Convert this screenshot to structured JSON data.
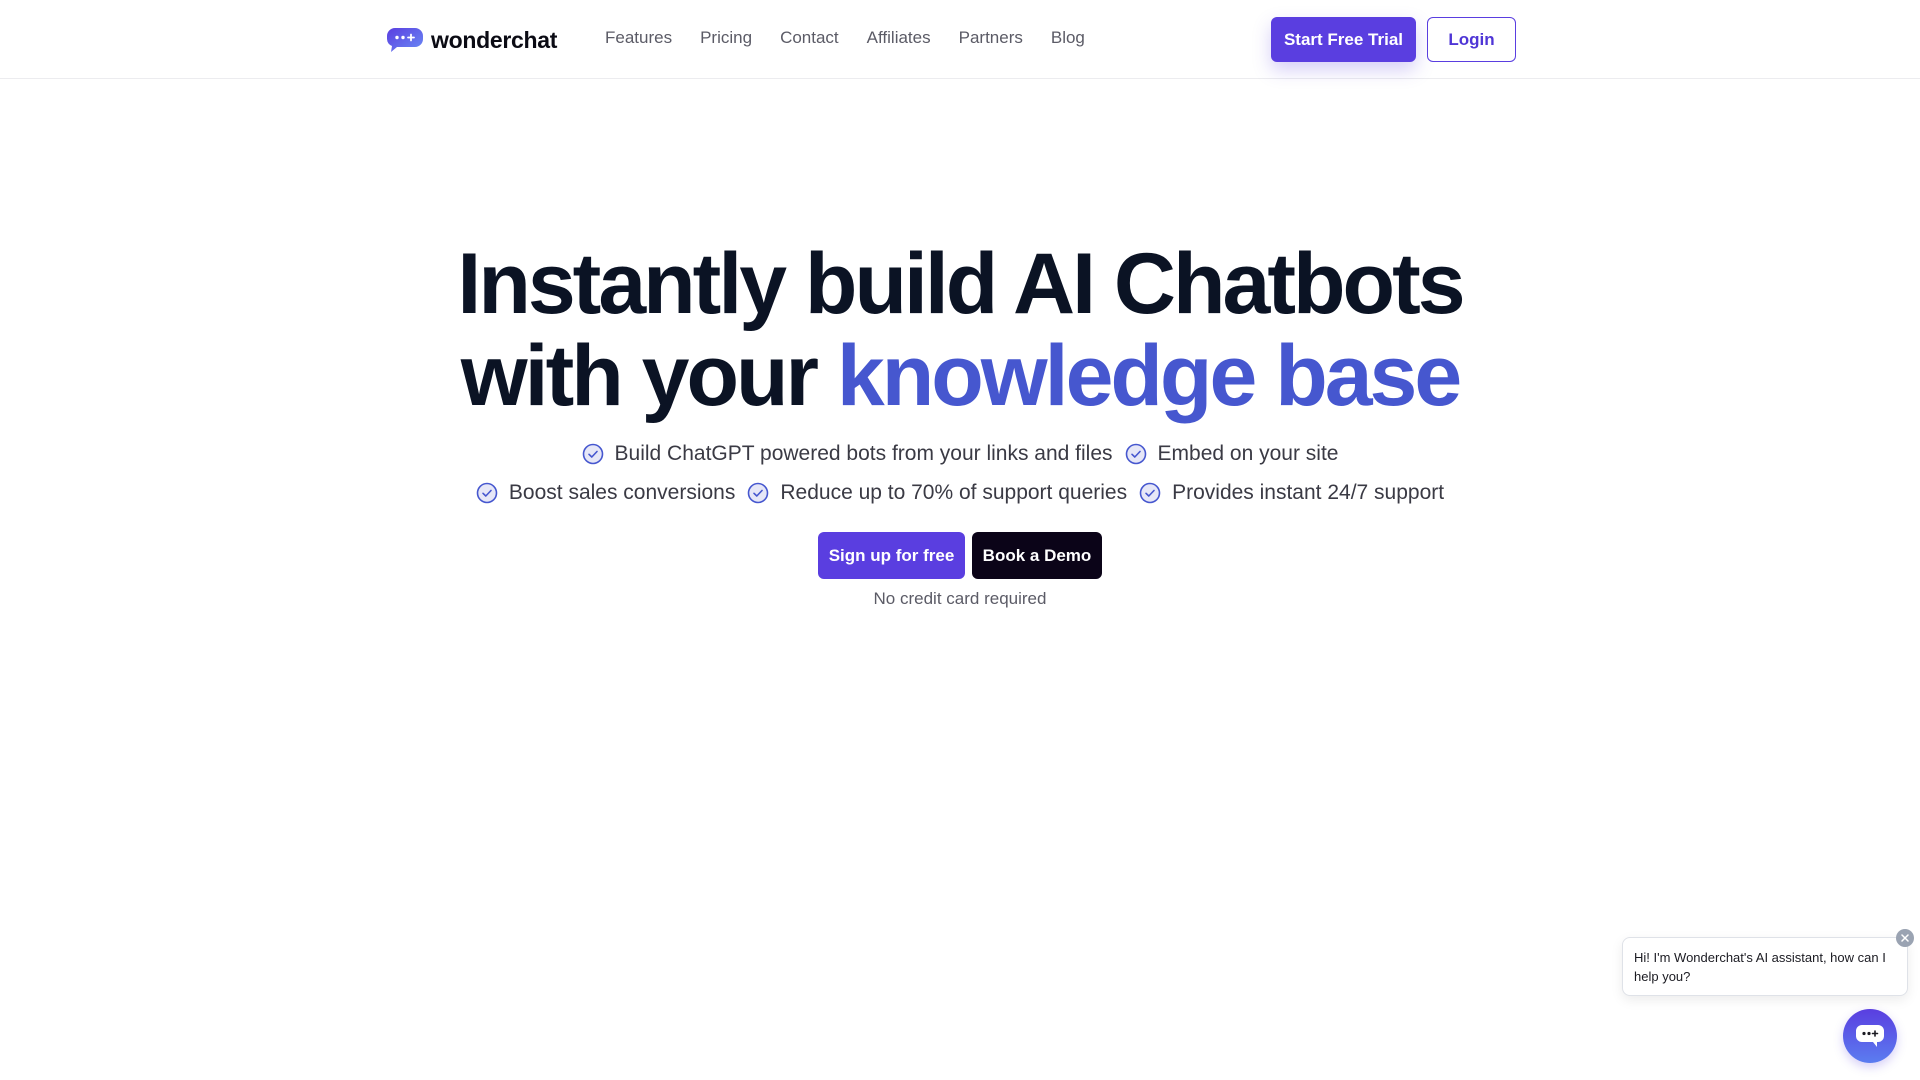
{
  "brand": {
    "name": "wonderchat",
    "accent_color": "#5a3ee0",
    "highlight_color": "#4657cf"
  },
  "nav": {
    "links": [
      {
        "label": "Features"
      },
      {
        "label": "Pricing"
      },
      {
        "label": "Contact"
      },
      {
        "label": "Affiliates"
      },
      {
        "label": "Partners"
      },
      {
        "label": "Blog"
      }
    ],
    "start_trial_label": "Start Free Trial",
    "login_label": "Login"
  },
  "hero": {
    "title_line1": "Instantly build AI Chatbots",
    "title_line2_prefix": "with your ",
    "title_line2_accent": "knowledge base",
    "features_row1": [
      {
        "icon": "check-circle-icon",
        "text": "Build ChatGPT powered bots from your links and files"
      },
      {
        "icon": "check-circle-icon",
        "text": "Embed on your site"
      }
    ],
    "features_row2": [
      {
        "icon": "check-circle-icon",
        "text": "Boost sales conversions"
      },
      {
        "icon": "check-circle-icon",
        "text": "Reduce up to 70% of support queries"
      },
      {
        "icon": "check-circle-icon",
        "text": "Provides instant 24/7 support"
      }
    ],
    "signup_label": "Sign up for free",
    "demo_label": "Book a Demo",
    "note": "No credit card required"
  },
  "chat_widget": {
    "greeting": "Hi! I'm Wonderchat's AI assistant, how can I help you?",
    "close_icon": "close-icon",
    "launcher_icon": "chat-bubble-icon"
  }
}
